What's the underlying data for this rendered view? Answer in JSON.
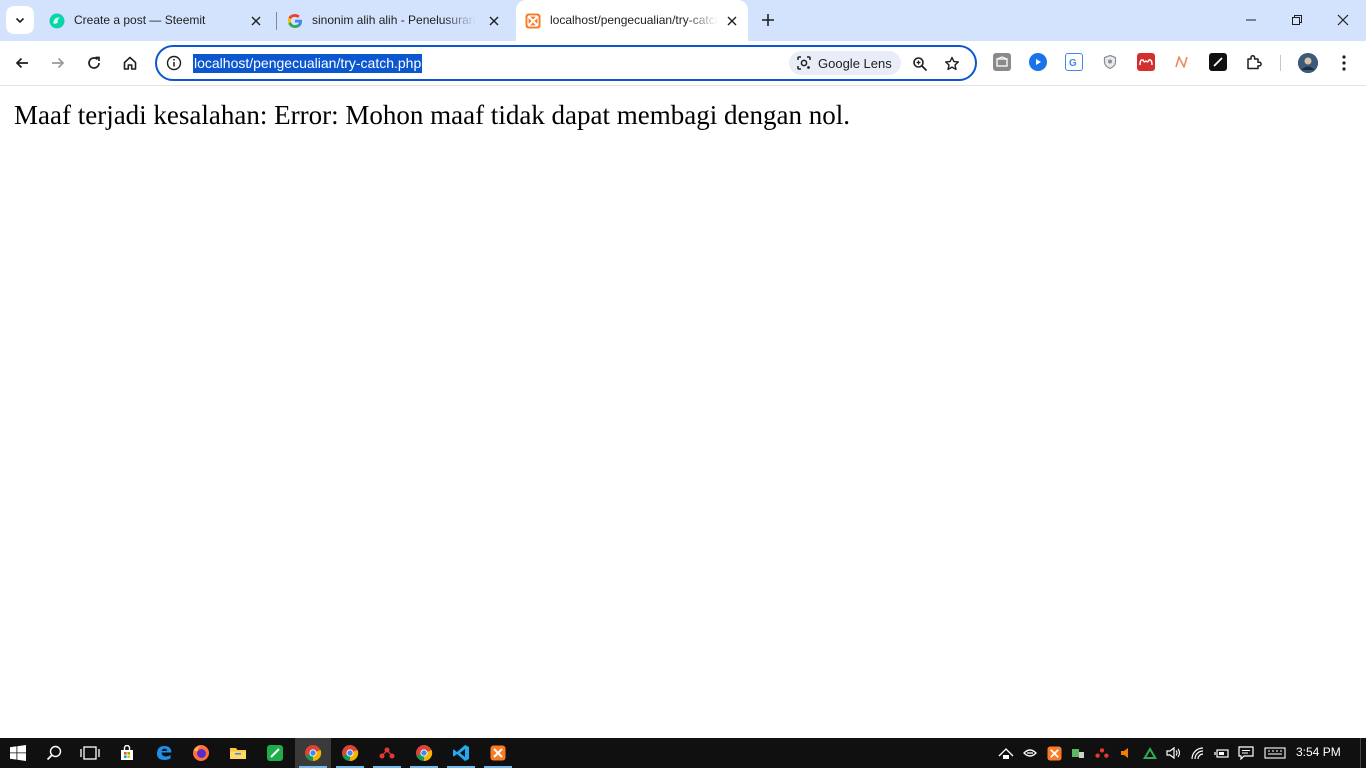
{
  "browser": {
    "tabs": [
      {
        "title": "Create a post — Steemit",
        "favicon": "steemit-icon",
        "active": false
      },
      {
        "title": "sinonim alih alih - Penelusuran G",
        "favicon": "google-icon",
        "active": false
      },
      {
        "title": "localhost/pengecualian/try-catch.php",
        "favicon": "xampp-icon",
        "active": true
      }
    ],
    "address_bar": {
      "url": "localhost/pengecualian/try-catch.php",
      "lens_label": "Google Lens"
    },
    "extensions": [
      "box-extension-icon",
      "play-extension-icon",
      "translate-extension-icon",
      "shield-extension-icon",
      "mendeley-extension-icon",
      "n-extension-icon",
      "pen-extension-icon",
      "puzzle-extensions-icon"
    ],
    "accent_color": "#0b57d0",
    "tabstrip_color": "#d3e3fd"
  },
  "page": {
    "message": "Maaf terjadi kesalahan: Error: Mohon maaf tidak dapat membagi dengan nol."
  },
  "taskbar": {
    "apps": [
      "windows-start-icon",
      "search-icon",
      "task-view-icon",
      "store-icon",
      "edge-icon",
      "firefox-icon",
      "file-explorer-icon",
      "green-app-icon",
      "chrome-icon",
      "chrome-icon",
      "red-app-icon",
      "chrome-icon",
      "vscode-icon",
      "xampp-icon"
    ],
    "clock": "3:54 PM"
  }
}
